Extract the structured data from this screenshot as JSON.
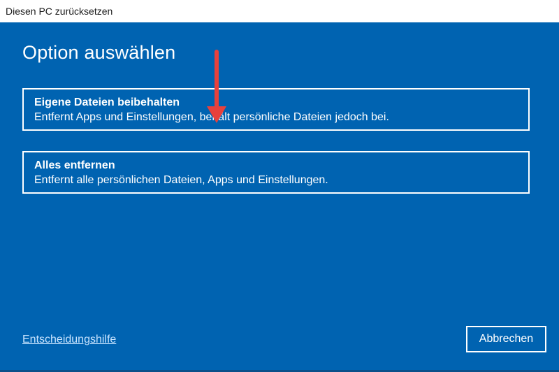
{
  "window": {
    "title": "Diesen PC zurücksetzen"
  },
  "main": {
    "heading": "Option auswählen",
    "options": [
      {
        "title": "Eigene Dateien beibehalten",
        "description": "Entfernt Apps und Einstellungen, behält persönliche Dateien jedoch bei."
      },
      {
        "title": "Alles entfernen",
        "description": "Entfernt alle persönlichen Dateien, Apps und Einstellungen."
      }
    ]
  },
  "footer": {
    "help_link": "Entscheidungshilfe",
    "cancel_label": "Abbrechen"
  },
  "colors": {
    "background": "#0063b1",
    "text": "#ffffff",
    "link": "#c9e4ff",
    "annotation_arrow": "#e8413c"
  },
  "icons": {
    "annotation": "down-arrow-icon"
  }
}
